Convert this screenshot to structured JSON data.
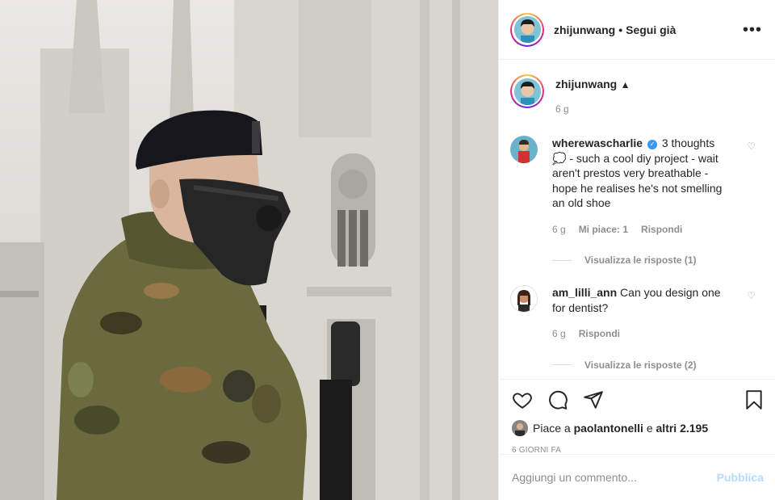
{
  "post": {
    "author": "zhijunwang",
    "separator": "•",
    "follow_label": "Segui già",
    "more_icon": "more-horizontal-icon"
  },
  "caption": {
    "username": "zhijunwang",
    "emoji": "▲",
    "age": "6 g"
  },
  "comments": [
    {
      "username": "wherewascharlie",
      "verified": true,
      "text": "3 thoughts 💭 - such a cool diy project - wait aren't prestos very breathable - hope he realises he's not smelling an old shoe",
      "age": "6 g",
      "likes_label": "Mi piace: 1",
      "reply_label": "Rispondi",
      "view_replies": "Visualizza le risposte (1)"
    },
    {
      "username": "am_lilli_ann",
      "verified": false,
      "text": "Can you design one for dentist?",
      "age": "6 g",
      "reply_label": "Rispondi",
      "view_replies": "Visualizza le risposte (2)"
    }
  ],
  "likes": {
    "prefix": "Piace a",
    "user": "paolantonelli",
    "conjunction": "e",
    "others": "altri 2.195"
  },
  "date": "6 GIORNI FA",
  "add_comment": {
    "placeholder": "Aggiungi un commento...",
    "publish_label": "Pubblica"
  },
  "colors": {
    "text": "#262626",
    "muted": "#8e8e8e",
    "link_disabled": "#b3dbff",
    "verified": "#3897f0"
  }
}
